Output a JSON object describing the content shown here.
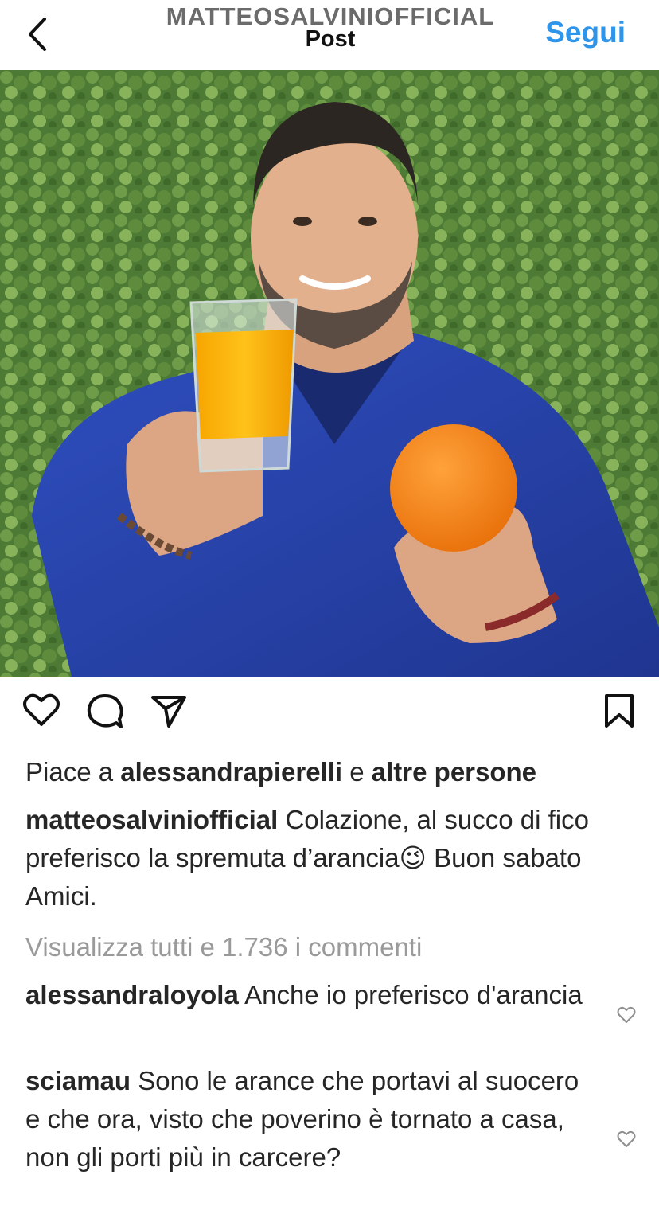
{
  "header": {
    "username": "MATTEOSALVINIOFFICIAL",
    "subtitle": "Post",
    "follow_label": "Segui"
  },
  "post": {
    "icons": {
      "back": "chevron-left-icon",
      "like": "heart-icon",
      "comment": "comment-icon",
      "share": "send-icon",
      "save": "bookmark-icon"
    },
    "likes": {
      "prefix": "Piace a",
      "user": "alessandrapierelli",
      "joiner": "e",
      "others": "altre persone"
    },
    "caption": {
      "username": "matteosalviniofficial",
      "text": "Colazione, al succo di fico preferisco la spremuta d’arancia😉 Buon sabato Amici."
    },
    "view_all_comments": "Visualizza tutti e 1.736 i commenti",
    "comments": [
      {
        "username": "alessandraloyola",
        "text": "Anche io preferisco d'arancia"
      },
      {
        "username": "sciamau",
        "text": "Sono le arance che portavi al suocero e che ora, visto che poverino è tornato a casa, non gli porti più in carcere?"
      }
    ]
  },
  "colors": {
    "accent": "#2f95ea",
    "muted": "#9a9a9a",
    "text": "#262626"
  }
}
